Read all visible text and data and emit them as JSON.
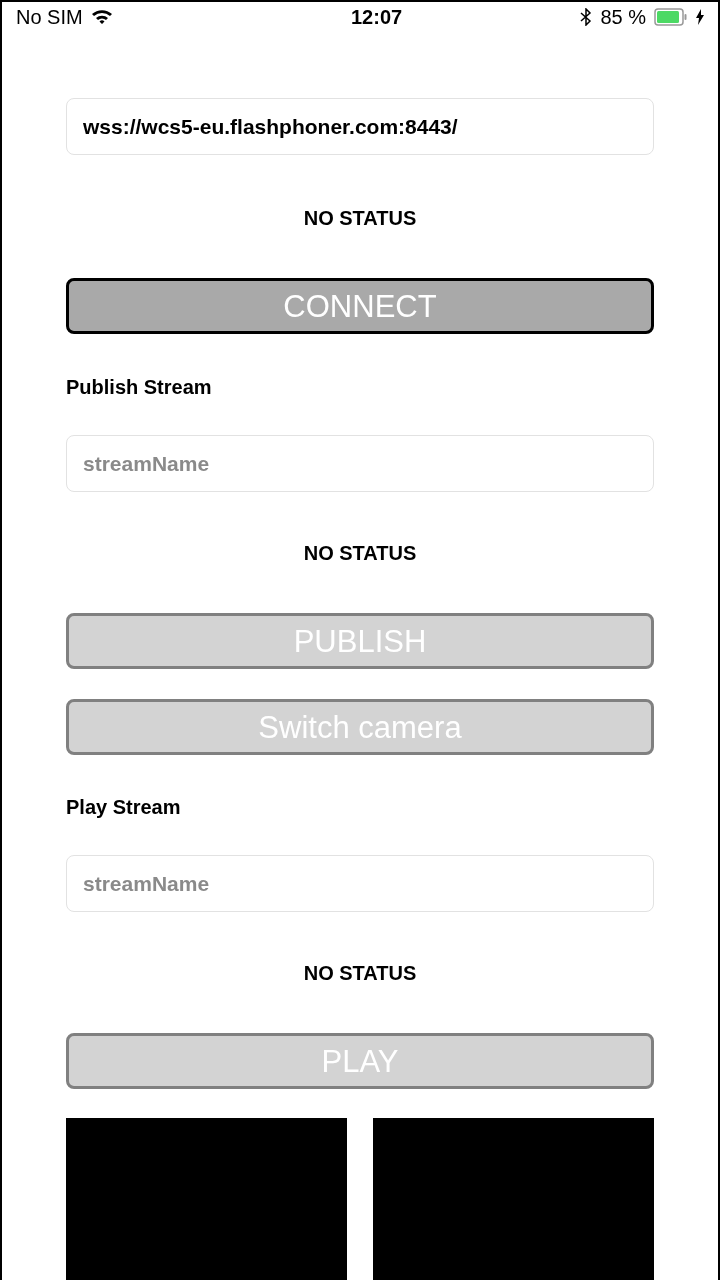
{
  "status_bar": {
    "carrier": "No SIM",
    "time": "12:07",
    "battery": "85 %"
  },
  "server": {
    "field": {
      "value": "wss://wcs5-eu.flashphoner.com:8443/"
    },
    "status": "NO STATUS",
    "button": {
      "label": "CONNECT",
      "disabled": false
    }
  },
  "publish": {
    "title": "Publish Stream",
    "field": {
      "placeholder": "streamName"
    },
    "status": "NO STATUS",
    "buttons": [
      {
        "label": "PUBLISH",
        "disabled": true
      },
      {
        "label": "Switch camera",
        "disabled": true
      }
    ]
  },
  "play": {
    "title": "Play Stream",
    "field": {
      "placeholder": "streamName"
    },
    "status": "NO STATUS",
    "buttons": [
      {
        "label": "PLAY",
        "disabled": true
      }
    ]
  }
}
